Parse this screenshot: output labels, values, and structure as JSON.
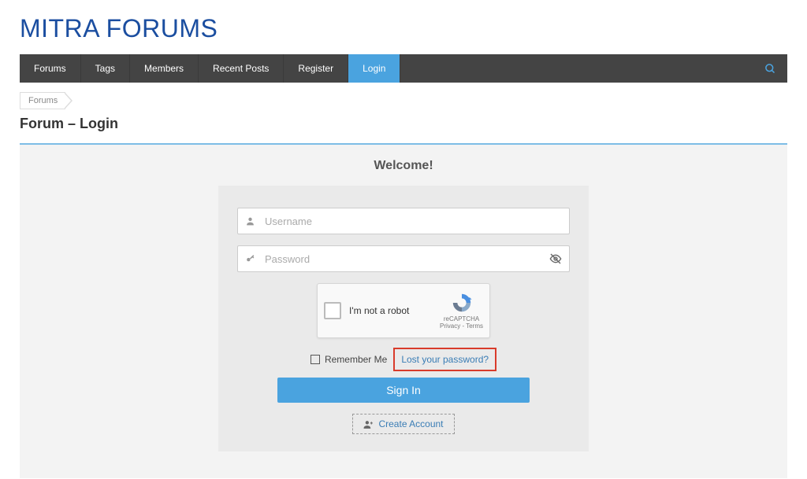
{
  "site": {
    "title": "MITRA FORUMS"
  },
  "nav": {
    "items": [
      {
        "label": "Forums"
      },
      {
        "label": "Tags"
      },
      {
        "label": "Members"
      },
      {
        "label": "Recent Posts"
      },
      {
        "label": "Register"
      },
      {
        "label": "Login"
      }
    ]
  },
  "breadcrumb": {
    "items": [
      {
        "label": "Forums"
      }
    ]
  },
  "page": {
    "title": "Forum – Login"
  },
  "login": {
    "welcome": "Welcome!",
    "username_placeholder": "Username",
    "password_placeholder": "Password",
    "captcha_label": "I'm not a robot",
    "captcha_brand": "reCAPTCHA",
    "captcha_legal": "Privacy - Terms",
    "remember_label": "Remember Me",
    "lost_password": "Lost your password?",
    "signin_label": "Sign In",
    "create_account": "Create Account"
  }
}
